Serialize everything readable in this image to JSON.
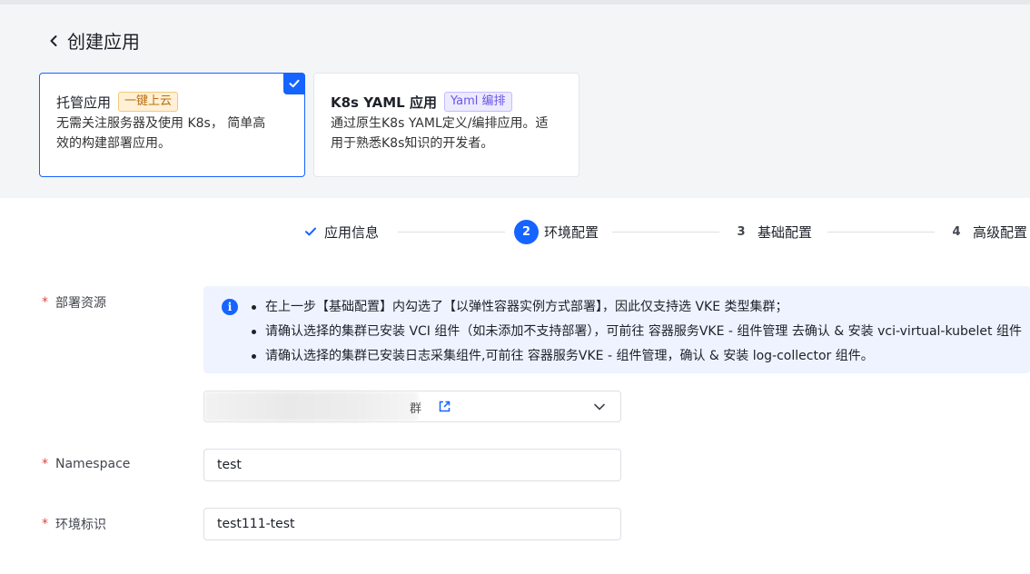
{
  "header": {
    "title": "创建应用"
  },
  "cards": [
    {
      "title": "托管应用",
      "tag": "一键上云",
      "desc_line1": "无需关注服务器及使用 K8s， 简单高",
      "desc_line2": "效的构建部署应用。",
      "selected": true
    },
    {
      "title": "K8s YAML 应用",
      "tag": "Yaml 编排",
      "desc_line1": "通过原生K8s YAML定义/编排应用。适",
      "desc_line2": "用于熟悉K8s知识的开发者。",
      "selected": false
    }
  ],
  "steps": [
    {
      "num": "",
      "label": "应用信息",
      "state": "done"
    },
    {
      "num": "2",
      "label": "环境配置",
      "state": "active"
    },
    {
      "num": "3",
      "label": "基础配置",
      "state": "pending"
    },
    {
      "num": "4",
      "label": "高级配置",
      "state": "pending"
    }
  ],
  "form": {
    "deploy_resource": {
      "label": "部署资源",
      "info": [
        "在上一步【基础配置】内勾选了【以弹性容器实例方式部署】，因此仅支持选 VKE 类型集群；",
        "请确认选择的集群已安装 VCI 组件（如未添加不支持部署），可前往 容器服务VKE - 组件管理 去确认 & 安装 vci-virtual-kubelet 组件",
        "请确认选择的集群已安装日志采集组件,可前往 容器服务VKE - 组件管理，确认 & 安装 log-collector 组件。"
      ],
      "select_suffix": "群"
    },
    "namespace": {
      "label": "Namespace",
      "value": "test"
    },
    "env_tag": {
      "label": "环境标识",
      "value": "test111-test"
    }
  },
  "colors": {
    "primary": "#1664ff",
    "required": "#e3453b",
    "info_bg": "#eef3ff"
  }
}
